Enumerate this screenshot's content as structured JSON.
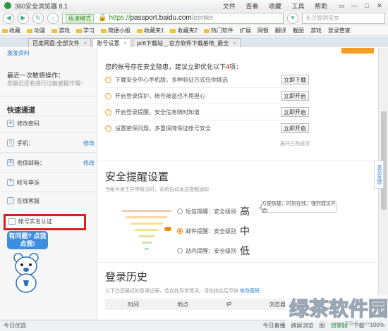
{
  "window": {
    "title": "360安全浏览器 8.1",
    "menu": [
      "文件",
      "查看",
      "收藏",
      "工具",
      "帮助"
    ],
    "controls": [
      "▭",
      "—",
      "□",
      "✕"
    ]
  },
  "address": {
    "mode": "极速模式",
    "https": "https://",
    "domain": "passport.baidu.com",
    "path": "/center",
    "search_placeholder": "长沙致销宝女"
  },
  "bookmarks": [
    "收藏",
    "动漫",
    "游戏",
    "学习",
    "简便小报",
    "收藏夹1",
    "收藏夹2",
    "热门软件",
    "扩展",
    "网银",
    "翻译",
    "截图",
    "游戏",
    "登录管家"
  ],
  "tabs": [
    {
      "label": "百度网盘-全部文件",
      "active": false
    },
    {
      "label": "账号设置",
      "active": true
    },
    {
      "label": "pc6下载站 _ 官方软件下载基地_最全",
      "active": false
    }
  ],
  "sidebar": {
    "status_link": "激发资料",
    "last_op_label": "最近一次敏感操作：",
    "last_op_value": "您最近还有进行过敏感操作哦~",
    "quick_title": "快速通道",
    "items": [
      {
        "label": "修改密码",
        "value": "",
        "edit": ""
      },
      {
        "label": "手机：",
        "value": "",
        "edit": "修改"
      },
      {
        "label": "密保邮箱：",
        "value": "",
        "edit": "修改"
      },
      {
        "label": "帐号申诉",
        "value": "",
        "edit": ""
      },
      {
        "label": "在线客服",
        "value": "",
        "edit": ""
      }
    ],
    "highlighted_item": "帐号实名认证",
    "bubble": "有问题? 点我点我!"
  },
  "main": {
    "intro_prefix": "您的帐号存在安全隐患，建议立即优化以下",
    "intro_count": "4",
    "intro_suffix": "项：",
    "rows": [
      {
        "text": "下载安全中心手机版，多种验证方式任你挑选",
        "button": "立即下载"
      },
      {
        "text": "开启登录保护，帐号被盗也不用担心",
        "button": "立即开启"
      },
      {
        "text": "开启登录提醒，安全信息随时知道",
        "button": "立即开启"
      },
      {
        "text": "设置密保问题，多重保障保证帐号安全",
        "button": "立即开启"
      }
    ],
    "collapse": "展开已完成项",
    "reminder_title": "安全提醒设置",
    "reminder_sub": "当帐号发生异常情况时，系统自动发送提醒通知",
    "levels": [
      {
        "label": "短信提醒：安全级别",
        "level": "高",
        "on": false
      },
      {
        "label": "邮件提醒：安全级别",
        "level": "中",
        "on": true
      },
      {
        "label": "站内提醒：安全级别",
        "level": "低",
        "on": false
      }
    ],
    "tip": "方便快捷，时刻在线，强烈建议开启!",
    "history_title": "登录历史",
    "history_sub": "以下为您最近的登录记录，若存在异常情况，请在核实后尽快",
    "history_link": "修改密码",
    "history_cols": [
      "时间",
      "地点",
      "IP",
      "浏览器"
    ]
  },
  "side_tab": "意见反馈",
  "statusbar": {
    "left": "今日优选",
    "right": [
      "今日直播",
      "跨屏浏览",
      "图",
      "加速器",
      "下载",
      "100%"
    ]
  },
  "watermark": {
    "text": "绿茶软件园",
    "sub": "www.33LC.com"
  }
}
